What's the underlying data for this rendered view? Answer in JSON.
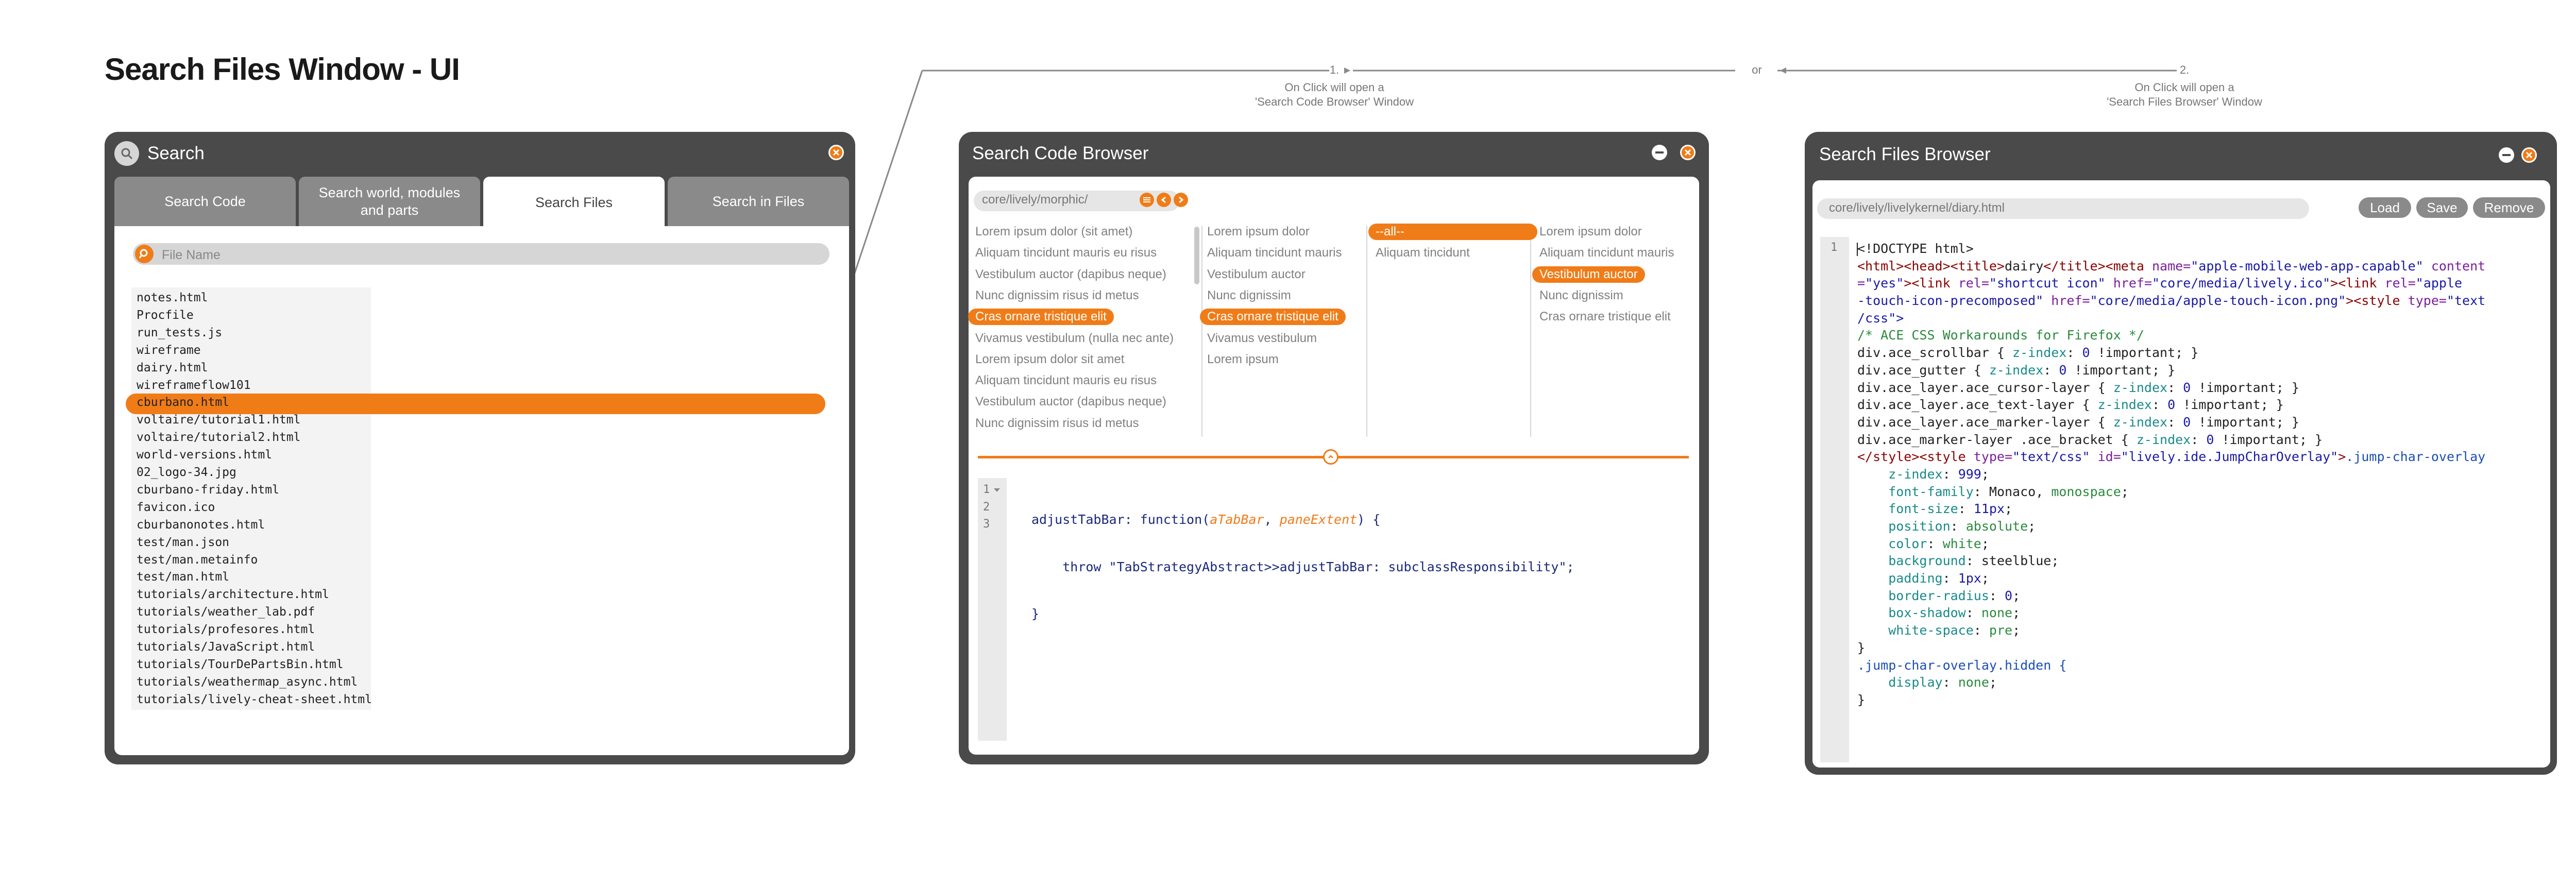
{
  "page_title": "Search Files Window - UI",
  "annotations": {
    "step1_num": "1.",
    "step1_text": "On Click will open a\n'Search Code Browser' Window",
    "or": "or",
    "step2_num": "2.",
    "step2_text": "On Click will open a\n'Search Files Browser' Window"
  },
  "colors": {
    "accent": "#f07c18",
    "window": "#4a4a4a",
    "tab": "#8a8a8a"
  },
  "search_window": {
    "title": "Search",
    "tabs": [
      {
        "label": "Search Code",
        "active": false
      },
      {
        "label": "Search world, modules and parts",
        "active": false
      },
      {
        "label": "Search Files",
        "active": true
      },
      {
        "label": "Search in Files",
        "active": false
      }
    ],
    "search_placeholder": "File Name",
    "search_value": "",
    "files": [
      "notes.html",
      "Procfile",
      "run_tests.js",
      "wireframe",
      "dairy.html",
      "wireframeflow101",
      "cburbano.html",
      "voltaire/tutorial1.html",
      "voltaire/tutorial2.html",
      "world-versions.html",
      "02_logo-34.jpg",
      "cburbano-friday.html",
      "favicon.ico",
      "cburbanonotes.html",
      "test/man.json",
      "test/man.metainfo",
      "test/man.html",
      "tutorials/architecture.html",
      "tutorials/weather_lab.pdf",
      "tutorials/profesores.html",
      "tutorials/JavaScript.html",
      "tutorials/TourDePartsBin.html",
      "tutorials/weathermap_async.html",
      "tutorials/lively-cheat-sheet.html"
    ],
    "selected_file": "cburbano.html"
  },
  "code_browser": {
    "title": "Search Code Browser",
    "path": "core/lively/morphic/",
    "pane1": [
      "Lorem ipsum dolor (sit amet)",
      "Aliquam tincidunt mauris eu risus",
      "Vestibulum auctor (dapibus neque)",
      "Nunc dignissim risus id metus",
      "Cras ornare tristique elit",
      "Vivamus vestibulum (nulla nec ante)",
      "Lorem ipsum dolor sit amet",
      "Aliquam tincidunt mauris eu risus",
      "Vestibulum auctor (dapibus neque)",
      "Nunc dignissim risus id metus"
    ],
    "pane2": [
      "Lorem ipsum dolor",
      "Aliquam tincidunt mauris",
      "Vestibulum auctor",
      "Nunc dignissim",
      "Cras ornare tristique elit",
      "Vivamus vestibulum",
      "Lorem ipsum"
    ],
    "pane3": [
      "--all--",
      "Aliquam tincidunt"
    ],
    "pane4": [
      "Lorem ipsum dolor",
      "Aliquam tincidunt mauris",
      "Vestibulum auctor",
      "Nunc dignissim",
      "Cras ornare tristique elit"
    ],
    "line_numbers": [
      "1",
      "2",
      "3"
    ],
    "code": {
      "l1a": "adjustTabBar: function(",
      "l1b": "aTabBar",
      "l1c": ", ",
      "l1d": "paneExtent",
      "l1e": ") {",
      "l2": "    throw \"TabStrategyAbstract>>adjustTabBar: subclassResponsibility\";",
      "l3": "}"
    }
  },
  "files_browser": {
    "title": "Search Files Browser",
    "path": "core/lively/livelykernel/diary.html",
    "buttons": [
      "Load",
      "Save",
      "Remove"
    ],
    "line_numbers": [
      "1"
    ],
    "code": {
      "l1": "<!DOCTYPE html>",
      "l2a": "<html><head><title>",
      "l2b": "dairy",
      "l2c": "</title><meta ",
      "l2d": "name=",
      "l2e": "\"apple-mobile-web-app-capable\"",
      "l2f": " content",
      "l3a": "=",
      "l3b": "\"yes\"",
      "l3c": "><link ",
      "l3d": "rel=",
      "l3e": "\"shortcut icon\"",
      "l3f": " href=",
      "l3g": "\"core/media/lively.ico\"",
      "l3h": "><link ",
      "l3i": "rel=",
      "l3j": "\"apple",
      "l4a": "-touch-icon-precomposed\"",
      "l4b": " href=",
      "l4c": "\"core/media/apple-touch-icon.png\"",
      "l4d": "><style ",
      "l4e": "type=",
      "l4f": "\"text",
      "l5": "/css\">",
      "l6": "/* ACE CSS Workarounds for Firefox */",
      "r1s": "div.ace_scrollbar",
      "r2s": "div.ace_gutter",
      "r3s": "div.ace_layer.ace_cursor-layer",
      "r4s": "div.ace_layer.ace_text-layer",
      "r5s": "div.ace_layer.ace_marker-layer",
      "r6s": "div.ace_marker-layer .ace_bracket",
      "ri_open": " { ",
      "ri_prop": "z-index",
      "ri_colon": ": ",
      "ri_val": "0",
      "ri_end": " !important; }",
      "l13a": "</style><style ",
      "l13b": "type=",
      "l13c": "\"text/css\"",
      "l13d": " id=",
      "l13e": "\"lively.ide.JumpCharOverlay\"",
      "l13f": ">",
      "l13g": ".jump-char-overlay",
      "p1": "z-index",
      "v1": "999",
      "p2": "font-family",
      "v2a": "Monaco",
      "v2b": ", ",
      "v2c": "monospace",
      "p3": "font-size",
      "v3": "11px",
      "p4": "position",
      "v4": "absolute",
      "p5": "color",
      "v5": "white",
      "p6": "background",
      "v6": "steelblue",
      "p7": "padding",
      "v7": "1px",
      "p8": "border-radius",
      "v8": "0",
      "p9": "box-shadow",
      "v9": "none",
      "p10": "white-space",
      "v10": "pre",
      "l24": "}",
      "l25": ".jump-char-overlay.hidden {",
      "p11": "display",
      "v11": "none",
      "l27": "}"
    }
  }
}
